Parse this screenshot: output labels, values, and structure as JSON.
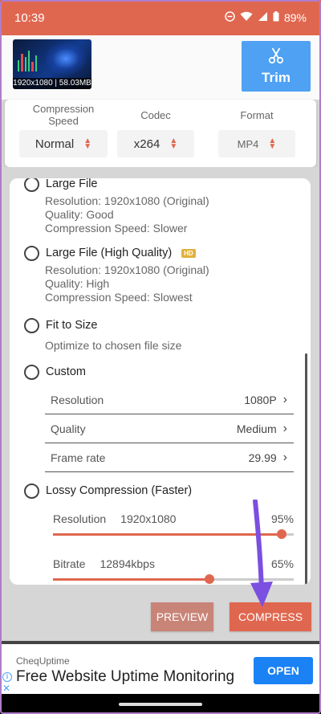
{
  "status": {
    "time": "10:39",
    "battery": "89%"
  },
  "video": {
    "caption": "1920x1080 | 58.03MB",
    "trim_label": "Trim"
  },
  "settings": [
    {
      "label": "Compression Speed",
      "value": "Normal"
    },
    {
      "label": "Codec",
      "value": "x264"
    },
    {
      "label": "Format",
      "value": "MP4"
    }
  ],
  "options": {
    "large_file": {
      "title": "Large File",
      "lines": [
        "Resolution: 1920x1080 (Original)",
        "Quality: Good",
        "Compression Speed: Slower"
      ]
    },
    "large_file_hq": {
      "title": "Large File (High Quality)",
      "badge": "HD",
      "lines": [
        "Resolution: 1920x1080 (Original)",
        "Quality: High",
        "Compression Speed: Slowest"
      ]
    },
    "fit_to_size": {
      "title": "Fit to Size",
      "desc": "Optimize to chosen file size"
    },
    "custom": {
      "title": "Custom",
      "rows": [
        {
          "label": "Resolution",
          "value": "1080P"
        },
        {
          "label": "Quality",
          "value": "Medium"
        },
        {
          "label": "Frame rate",
          "value": "29.99"
        }
      ]
    },
    "lossy": {
      "title": "Lossy Compression (Faster)",
      "resolution": {
        "label": "Resolution",
        "value": "1920x1080",
        "percent_label": "95%",
        "percent": 95
      },
      "bitrate": {
        "label": "Bitrate",
        "value": "12894kbps",
        "percent_label": "65%",
        "percent": 65
      }
    }
  },
  "actions": {
    "preview": "PREVIEW",
    "compress": "COMPRESS"
  },
  "ad": {
    "sponsor": "CheqUptime",
    "headline": "Free Website Uptime Monitoring",
    "cta": "OPEN"
  },
  "colors": {
    "accent": "#e0674f",
    "trim": "#4ea1f3",
    "annotation": "#7b4fe0"
  }
}
